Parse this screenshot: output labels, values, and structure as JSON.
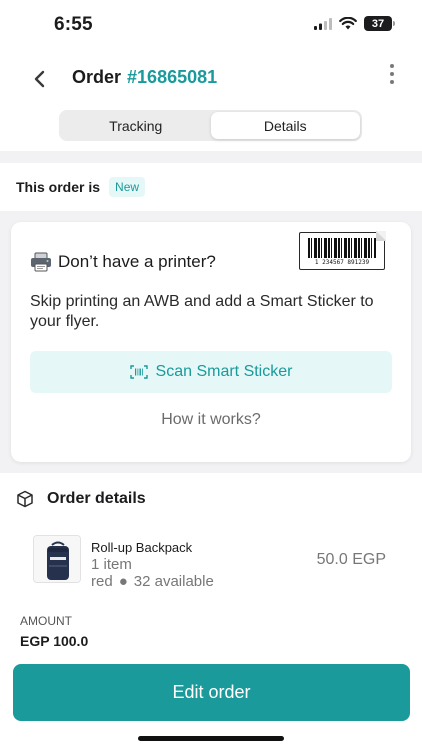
{
  "status_bar": {
    "time": "6:55",
    "battery": "37"
  },
  "header": {
    "title": "Order",
    "order_number": "#16865081"
  },
  "tabs": [
    {
      "label": "Tracking",
      "active": false
    },
    {
      "label": "Details",
      "active": true
    }
  ],
  "order_status": {
    "label": "This order is",
    "badge": "New"
  },
  "printer_card": {
    "title": "Don’t have a printer?",
    "barcode_number": "1 234567 891239",
    "description": "Skip printing an AWB and add a Smart Sticker to your flyer.",
    "scan_button": "Scan Smart Sticker",
    "how_link": "How it works?"
  },
  "order_details": {
    "title": "Order details",
    "item": {
      "name": "Roll-up Backpack",
      "quantity": "1 item",
      "color": "red",
      "availability": "32 available",
      "price": "50.0 EGP"
    },
    "amount_label": "AMOUNT",
    "amount_value": "EGP 100.0"
  },
  "actions": {
    "edit_order": "Edit order"
  },
  "colors": {
    "accent": "#1a9a9a",
    "accent_light": "#e6f7f7",
    "band": "#f2f2f4"
  },
  "icons": [
    "signal-icon",
    "wifi-icon",
    "battery-icon",
    "back-chevron-icon",
    "more-vertical-icon",
    "printer-icon",
    "barcode-sticker-icon",
    "scan-icon",
    "box-icon"
  ]
}
